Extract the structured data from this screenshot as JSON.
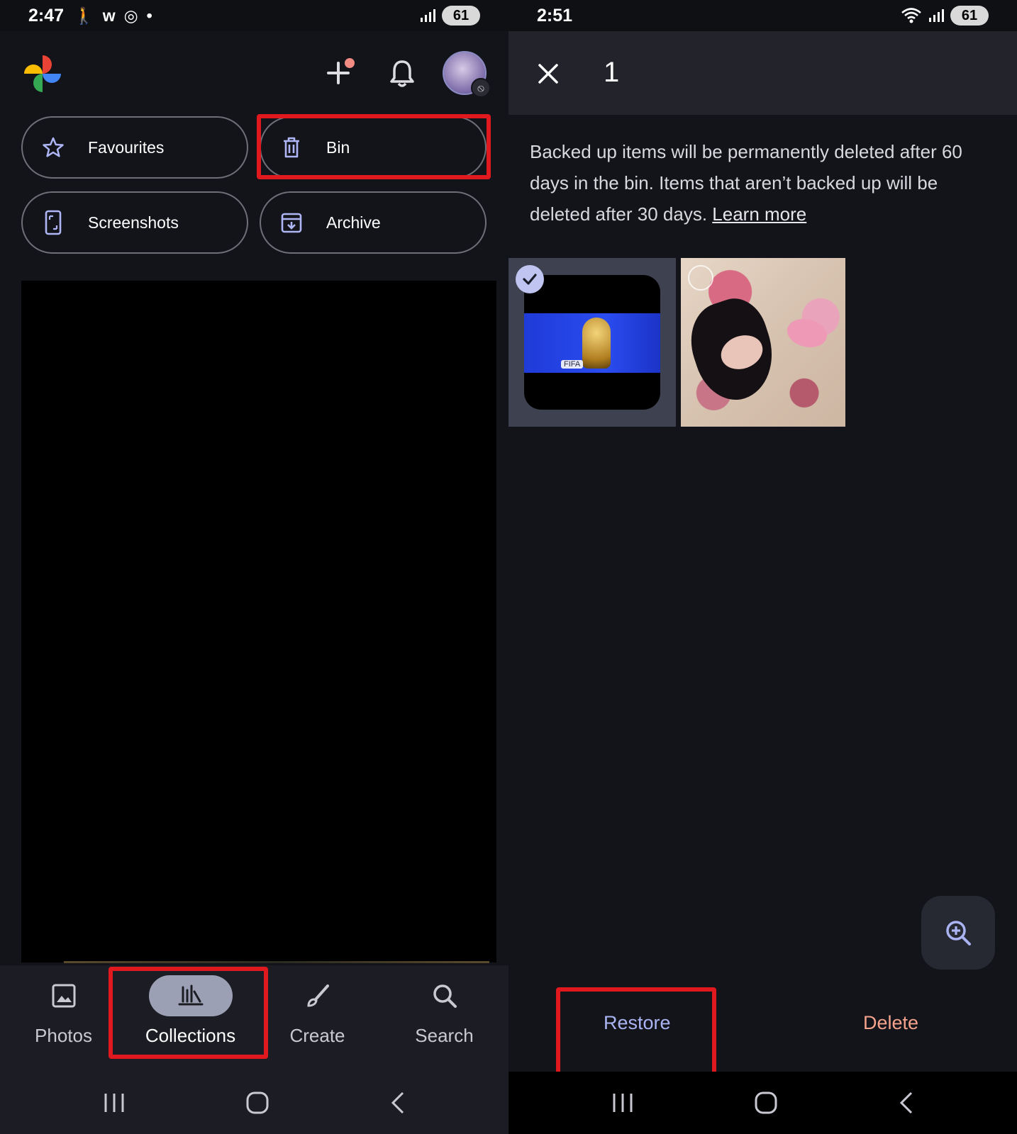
{
  "left": {
    "status": {
      "time": "2:47",
      "battery": "61"
    },
    "chips": {
      "favourites": "Favourites",
      "bin": "Bin",
      "screenshots": "Screenshots",
      "archive": "Archive"
    },
    "bottom_nav": {
      "photos": "Photos",
      "collections": "Collections",
      "create": "Create",
      "search": "Search"
    }
  },
  "right": {
    "status": {
      "time": "2:51",
      "battery": "61"
    },
    "selection_count": "1",
    "info_text": "Backed up items will be permanently deleted after 60 days in the bin. Items that aren’t backed up will be deleted after 30 days.",
    "learn_more": "Learn more",
    "thumb_label": "FIFA",
    "actions": {
      "restore": "Restore",
      "delete": "Delete"
    }
  },
  "icons": [
    "google-photos-logo",
    "add-icon",
    "bell-icon",
    "star-icon",
    "trash-icon",
    "phone-screenshot-icon",
    "archive-icon",
    "photo-icon",
    "collections-icon",
    "brush-icon",
    "search-icon",
    "close-icon",
    "check-icon",
    "zoom-in-icon"
  ],
  "colors": {
    "highlight": "#e0191f",
    "restore": "#aab4f2",
    "delete": "#f4a28c",
    "active_nav": "#9ca0b4"
  }
}
